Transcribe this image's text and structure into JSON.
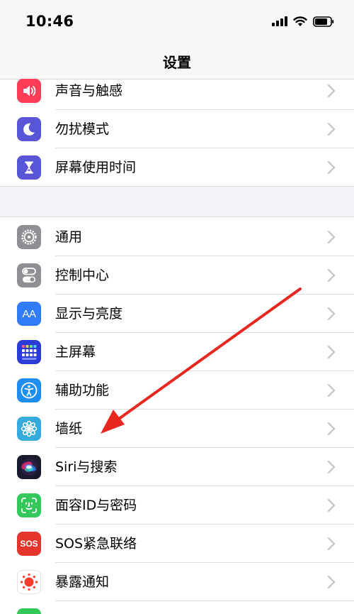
{
  "status": {
    "time": "10:46"
  },
  "nav": {
    "title": "设置"
  },
  "group1": [
    {
      "label": "声音与触感",
      "icon": "speaker-icon",
      "color": "#ff3b58"
    },
    {
      "label": "勿扰模式",
      "icon": "moon-icon",
      "color": "#5856d6"
    },
    {
      "label": "屏幕使用时间",
      "icon": "hourglass-icon",
      "color": "#5856d6"
    }
  ],
  "group2": [
    {
      "label": "通用",
      "icon": "gear-icon",
      "color": "#8e8e93"
    },
    {
      "label": "控制中心",
      "icon": "toggles-icon",
      "color": "#8e8e93"
    },
    {
      "label": "显示与亮度",
      "icon": "text-size-icon",
      "color": "#2f7cf6",
      "text": "AA"
    },
    {
      "label": "主屏幕",
      "icon": "home-grid-icon",
      "color": "#2b3bd8"
    },
    {
      "label": "辅助功能",
      "icon": "accessibility-icon",
      "color": "#1f8ef1"
    },
    {
      "label": "墙纸",
      "icon": "flower-icon",
      "color": "#35aadc"
    },
    {
      "label": "Siri与搜索",
      "icon": "siri-icon",
      "color": "#1a1a2e"
    },
    {
      "label": "面容ID与密码",
      "icon": "face-id-icon",
      "color": "#34c759"
    },
    {
      "label": "SOS紧急联络",
      "icon": "sos-icon",
      "color": "#e5342b",
      "text": "SOS"
    },
    {
      "label": "暴露通知",
      "icon": "exposure-icon",
      "color": "#ffffff"
    }
  ],
  "colors": {
    "annotation_arrow": "#e8271f"
  }
}
